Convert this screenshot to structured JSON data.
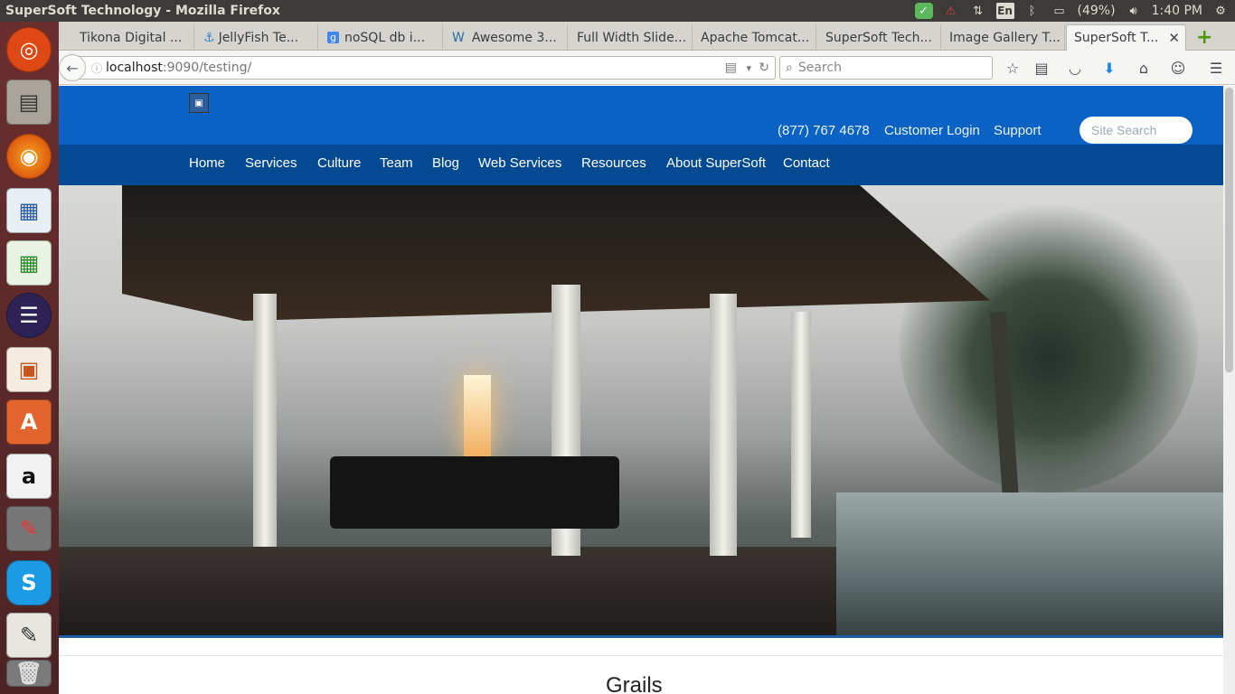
{
  "window": {
    "title": "SuperSoft Technology - Mozilla Firefox"
  },
  "tray": {
    "battery": "(49%)",
    "time": "1:40 PM",
    "keyboard": "En"
  },
  "launcher": {
    "apps": [
      "ubuntu-icon",
      "files-icon",
      "firefox-icon",
      "writer-icon",
      "calc-icon",
      "eclipse-icon",
      "impress-icon",
      "software-center-icon",
      "amazon-icon",
      "settings-icon",
      "skype-icon",
      "text-editor-icon",
      "trash-icon"
    ]
  },
  "tabs": [
    {
      "label": "Tikona Digital ..."
    },
    {
      "label": "JellyFish Te..."
    },
    {
      "label": "noSQL db i..."
    },
    {
      "label": "Awesome 3..."
    },
    {
      "label": "Full Width Slide..."
    },
    {
      "label": "Apache Tomcat..."
    },
    {
      "label": "SuperSoft Tech..."
    },
    {
      "label": "Image Gallery T..."
    },
    {
      "label": "SuperSoft T..."
    }
  ],
  "browser": {
    "url_host": "localhost",
    "url_rest": ":9090/testing/",
    "search_placeholder": "Search"
  },
  "site": {
    "phone": "(877) 767 4678",
    "customer_login": "Customer Login",
    "support": "Support",
    "search_placeholder": "Site Search",
    "menu": [
      "Home",
      "Services",
      "Culture",
      "Team",
      "Blog",
      "Web Services",
      "Resources",
      "About SuperSoft",
      "Contact"
    ],
    "section_heading": "Grails"
  },
  "colors": {
    "header_blue": "#0a63c4",
    "menu_blue": "#034a92"
  }
}
